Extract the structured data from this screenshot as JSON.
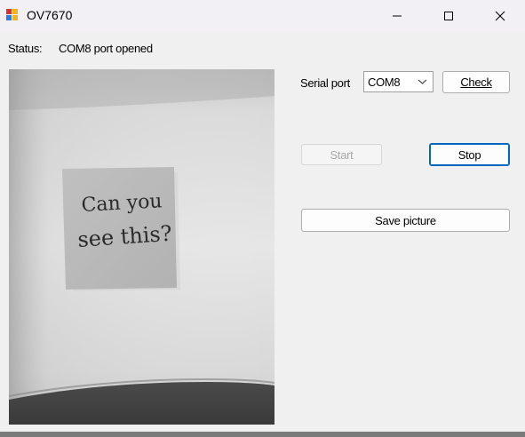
{
  "window": {
    "title": "OV7670",
    "controls": {
      "minimize": "minimize-icon",
      "maximize": "maximize-icon",
      "close": "close-icon"
    }
  },
  "status": {
    "label": "Status:",
    "value": "COM8 port opened"
  },
  "camera": {
    "note_line1": "Can you",
    "note_line2": "see this?"
  },
  "serial": {
    "label": "Serial port",
    "selected": "COM8"
  },
  "buttons": {
    "check": "Check",
    "start": "Start",
    "stop": "Stop",
    "save": "Save picture"
  },
  "colors": {
    "focus_accent": "#0067c0",
    "disabled_text": "#a8a8a8"
  }
}
